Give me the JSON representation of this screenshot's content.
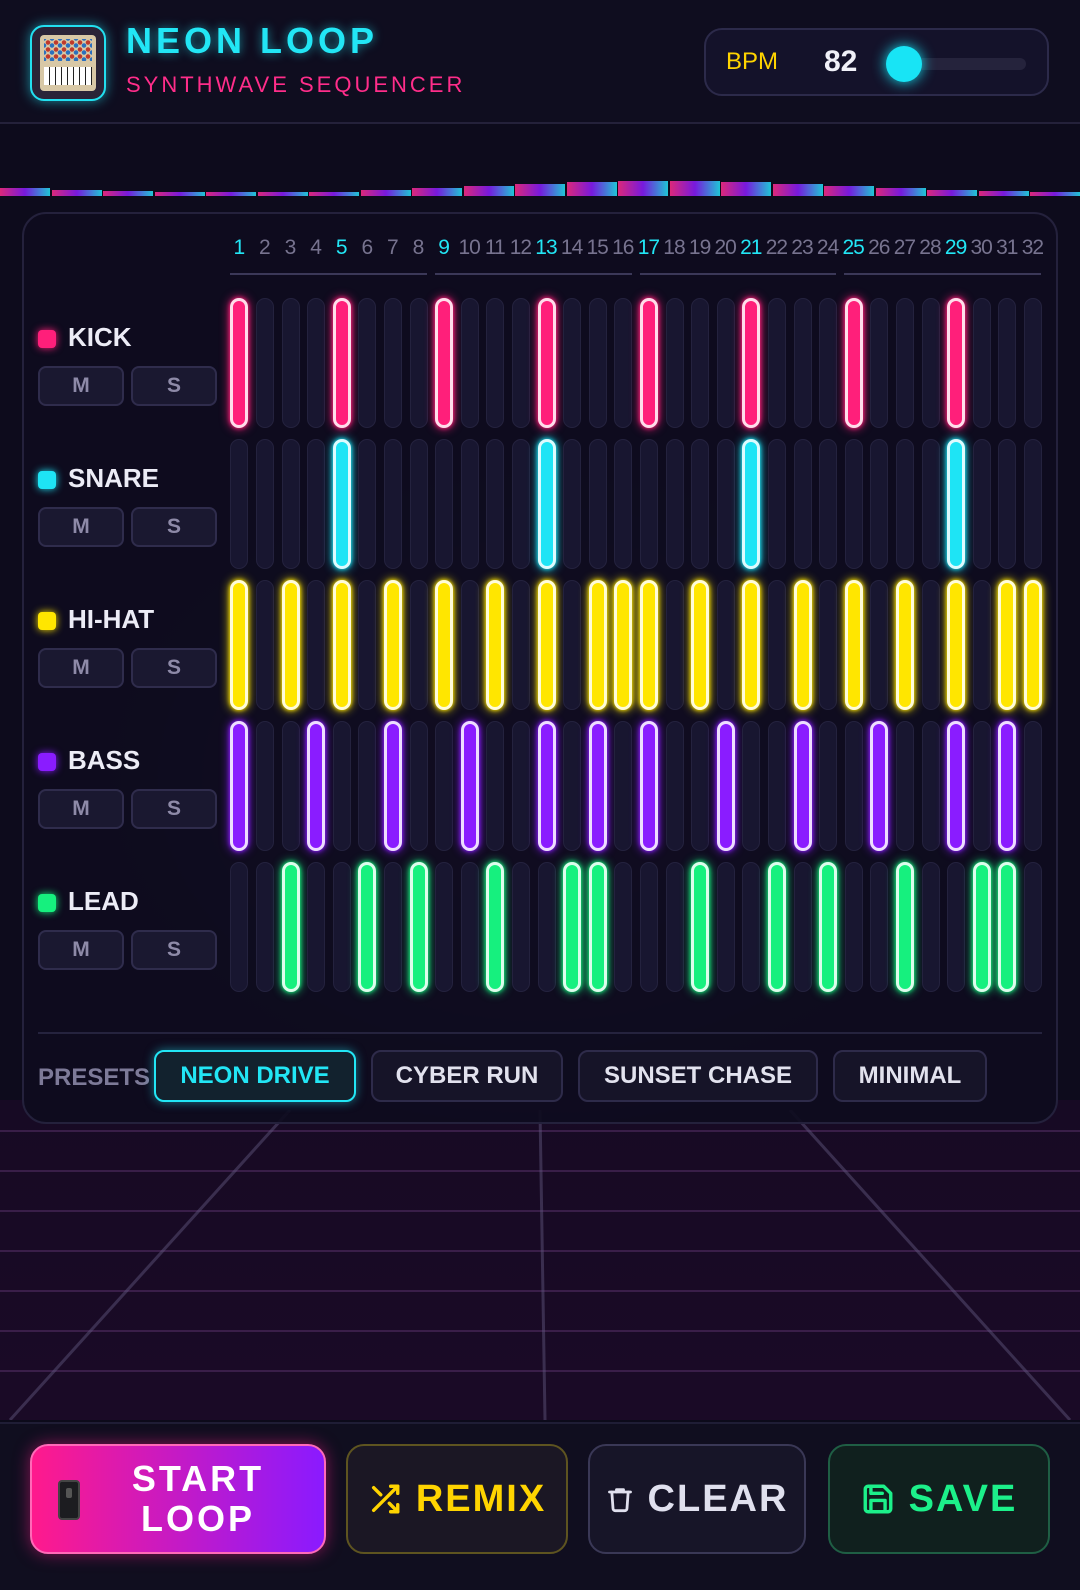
{
  "app": {
    "title": "NEON LOOP",
    "subtitle": "SYNTHWAVE SEQUENCER"
  },
  "bpm": {
    "label": "BPM",
    "value": "82",
    "slider_fraction": 0.1
  },
  "colors": {
    "kick": "#ff1f7a",
    "snare": "#1ee4f5",
    "hihat": "#ffe600",
    "bass": "#8a1cff",
    "lead": "#16f07e",
    "accent": "#22e6f5"
  },
  "steps": [
    "1",
    "2",
    "3",
    "4",
    "5",
    "6",
    "7",
    "8",
    "9",
    "10",
    "11",
    "12",
    "13",
    "14",
    "15",
    "16",
    "17",
    "18",
    "19",
    "20",
    "21",
    "22",
    "23",
    "24",
    "25",
    "26",
    "27",
    "28",
    "29",
    "30",
    "31",
    "32"
  ],
  "beat_steps": [
    1,
    5,
    9,
    13,
    17,
    21,
    25,
    29
  ],
  "tracks": [
    {
      "name": "KICK",
      "color_key": "kick",
      "mute": "M",
      "solo": "S",
      "active": [
        1,
        5,
        9,
        13,
        17,
        21,
        25,
        29
      ]
    },
    {
      "name": "SNARE",
      "color_key": "snare",
      "mute": "M",
      "solo": "S",
      "active": [
        5,
        13,
        21,
        29
      ]
    },
    {
      "name": "HI-HAT",
      "color_key": "hihat",
      "mute": "M",
      "solo": "S",
      "active": [
        1,
        3,
        5,
        7,
        9,
        11,
        13,
        15,
        16,
        17,
        19,
        21,
        23,
        25,
        27,
        29,
        31,
        32
      ]
    },
    {
      "name": "BASS",
      "color_key": "bass",
      "mute": "M",
      "solo": "S",
      "active": [
        1,
        4,
        7,
        10,
        13,
        15,
        17,
        20,
        23,
        26,
        29,
        31
      ]
    },
    {
      "name": "LEAD",
      "color_key": "lead",
      "mute": "M",
      "solo": "S",
      "active": [
        3,
        6,
        8,
        11,
        14,
        15,
        19,
        22,
        24,
        27,
        30,
        31
      ]
    }
  ],
  "presets": {
    "label": "PRESETS",
    "items": [
      "NEON DRIVE",
      "CYBER RUN",
      "SUNSET CHASE",
      "MINIMAL"
    ],
    "active": "NEON DRIVE"
  },
  "actions": {
    "start": "START LOOP",
    "start_icon": "phone-icon",
    "remix": "REMIX",
    "remix_icon": "shuffle-icon",
    "clear": "CLEAR",
    "clear_icon": "trash-icon",
    "save": "SAVE",
    "save_icon": "floppy-icon"
  }
}
